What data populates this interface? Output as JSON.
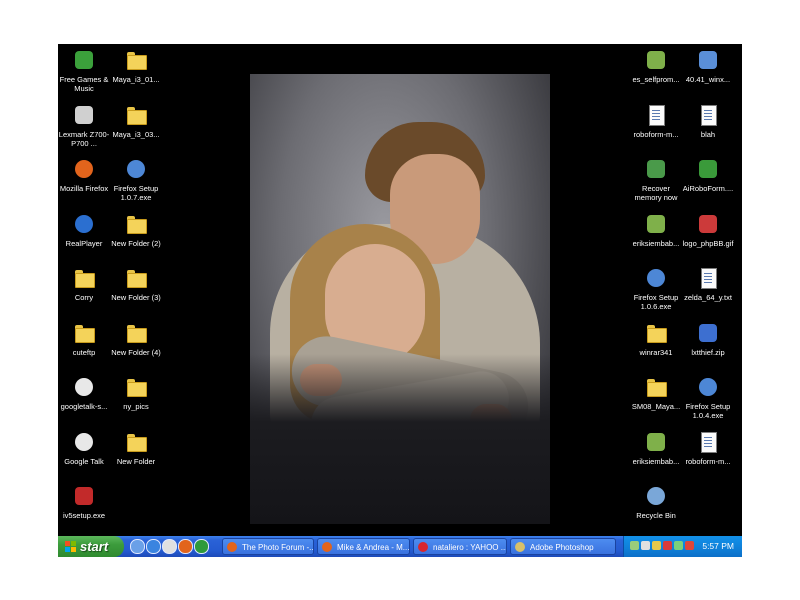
{
  "desktop": {
    "icons_left": [
      {
        "label": "Free Games & Music",
        "icon": "gift-box-icon",
        "type": "app",
        "color": "#3ba03b"
      },
      {
        "label": "Maya_i3_01...",
        "icon": "folder-icon",
        "type": "folder"
      },
      {
        "label": "Lexmark Z700-P700 ...",
        "icon": "printer-icon",
        "type": "app",
        "color": "#d0d0d0"
      },
      {
        "label": "Maya_i3_03...",
        "icon": "folder-icon",
        "type": "folder"
      },
      {
        "label": "Mozilla Firefox",
        "icon": "firefox-icon",
        "type": "round",
        "color": "#e2641c"
      },
      {
        "label": "Firefox Setup 1.0.7.exe",
        "icon": "installer-icon",
        "type": "round",
        "color": "#4d87d6"
      },
      {
        "label": "RealPlayer",
        "icon": "realplayer-icon",
        "type": "round",
        "color": "#2b6fd0"
      },
      {
        "label": "New Folder (2)",
        "icon": "folder-icon",
        "type": "folder"
      },
      {
        "label": "Corry",
        "icon": "folder-icon",
        "type": "folder"
      },
      {
        "label": "New Folder (3)",
        "icon": "folder-icon",
        "type": "folder"
      },
      {
        "label": "cuteftp",
        "icon": "folder-icon",
        "type": "folder"
      },
      {
        "label": "New Folder (4)",
        "icon": "folder-icon",
        "type": "folder"
      },
      {
        "label": "googletalk-s...",
        "icon": "google-talk-icon",
        "type": "round",
        "color": "#e8e8e8"
      },
      {
        "label": "ny_pics",
        "icon": "folder-icon",
        "type": "folder"
      },
      {
        "label": "Google Talk",
        "icon": "google-talk-icon",
        "type": "round",
        "color": "#e8e8e8"
      },
      {
        "label": "New Folder",
        "icon": "folder-icon",
        "type": "folder"
      },
      {
        "label": "iv5setup.exe",
        "icon": "setup-exe-icon",
        "type": "app",
        "color": "#c22a2a"
      }
    ],
    "icons_right": [
      {
        "label": "es_selfprom...",
        "icon": "image-file-icon",
        "type": "app",
        "color": "#7fb04a"
      },
      {
        "label": "40.41_winx...",
        "icon": "installer-icon",
        "type": "app",
        "color": "#5a8fd8"
      },
      {
        "label": "roboform-m...",
        "icon": "document-icon",
        "type": "doc"
      },
      {
        "label": "blah",
        "icon": "document-icon",
        "type": "doc"
      },
      {
        "label": "Recover memory now",
        "icon": "memory-tool-icon",
        "type": "app",
        "color": "#4a9a4a"
      },
      {
        "label": "AiRoboForm....",
        "icon": "roboform-icon",
        "type": "app",
        "color": "#3a9a3a"
      },
      {
        "label": "eriksiembab...",
        "icon": "image-file-icon",
        "type": "app",
        "color": "#7fb04a"
      },
      {
        "label": "logo_phpBB.gif",
        "icon": "gif-file-icon",
        "type": "app",
        "color": "#cc3a3a"
      },
      {
        "label": "Firefox Setup 1.0.6.exe",
        "icon": "installer-icon",
        "type": "round",
        "color": "#4d87d6"
      },
      {
        "label": "zelda_64_y.txt",
        "icon": "text-file-icon",
        "type": "doc"
      },
      {
        "label": "winrar341",
        "icon": "folder-icon",
        "type": "folder"
      },
      {
        "label": "lxtthief.zip",
        "icon": "zip-file-icon",
        "type": "app",
        "color": "#3d6fd0"
      },
      {
        "label": "SM08_Maya...",
        "icon": "folder-icon",
        "type": "folder"
      },
      {
        "label": "Firefox Setup 1.0.4.exe",
        "icon": "installer-icon",
        "type": "round",
        "color": "#4d87d6"
      },
      {
        "label": "eriksiembab...",
        "icon": "image-file-icon",
        "type": "app",
        "color": "#7fb04a"
      },
      {
        "label": "roboform-m...",
        "icon": "document-icon",
        "type": "doc"
      },
      {
        "label": "Recycle Bin",
        "icon": "recycle-bin-icon",
        "type": "round",
        "color": "#7aa7d8"
      }
    ]
  },
  "taskbar": {
    "start_label": "start",
    "quick_launch": [
      {
        "icon": "show-desktop-icon",
        "color": "#6aa0e8"
      },
      {
        "icon": "internet-explorer-icon",
        "color": "#3a84e0"
      },
      {
        "icon": "media-player-icon",
        "color": "#e0e0e0"
      },
      {
        "icon": "firefox-icon",
        "color": "#e2641c"
      },
      {
        "icon": "messenger-icon",
        "color": "#2e9a3c"
      }
    ],
    "tasks": [
      {
        "label": "The Photo Forum -...",
        "icon": "firefox-icon",
        "color": "#e2641c"
      },
      {
        "label": "Mike & Andrea - M...",
        "icon": "firefox-icon",
        "color": "#e2641c"
      },
      {
        "label": "nataliero : YAHOO ...",
        "icon": "yahoo-messenger-icon",
        "color": "#d8262e"
      },
      {
        "label": "Adobe Photoshop",
        "icon": "photoshop-icon",
        "color": "#d8c06a"
      }
    ],
    "tray_icons": [
      {
        "icon": "network-icon",
        "color": "#9acd7a"
      },
      {
        "icon": "antivirus-icon",
        "color": "#e0e0e0"
      },
      {
        "icon": "audio-icon",
        "color": "#e8c84a"
      },
      {
        "icon": "alert-icon",
        "color": "#d83a3a"
      },
      {
        "icon": "display-icon",
        "color": "#7ad07a"
      },
      {
        "icon": "messenger-tray-icon",
        "color": "#e0463a"
      }
    ],
    "clock": "5:57 PM"
  }
}
